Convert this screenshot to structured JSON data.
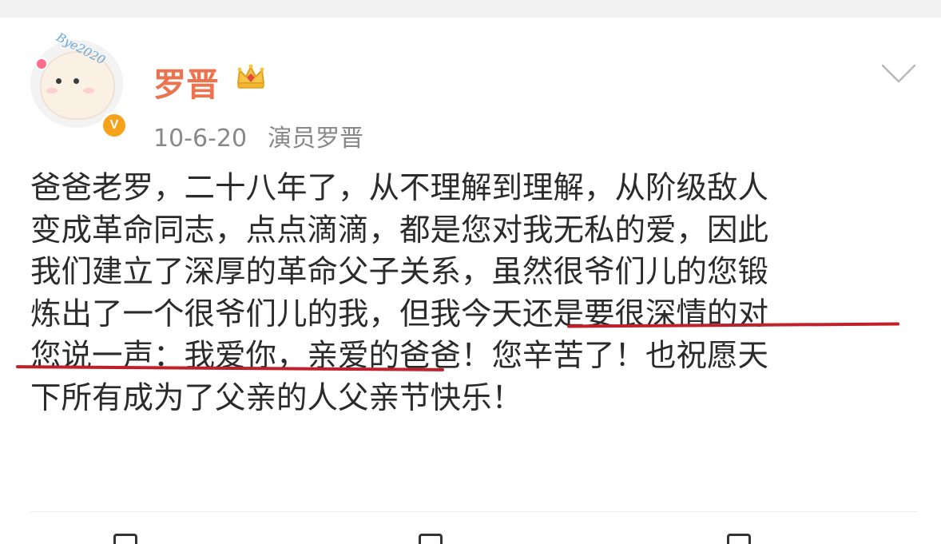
{
  "post": {
    "author": {
      "name": "罗晋",
      "avatar_caption": "Bye2020",
      "verified_mark": "V"
    },
    "meta": {
      "date": "10-6-20",
      "source": "演员罗晋"
    },
    "body_lines": [
      "爸爸老罗，二十八年了，从不理解到理解，从阶级敌人",
      "变成革命同志，点点滴滴，都是您对我无私的爱，因此",
      "我们建立了深厚的革命父子关系，虽然很爷们儿的您锻",
      "炼出了一个很爷们儿的我，但我今天还是要很深情的对",
      "您说一声：我爱你，亲爱的爸爸！您辛苦了！也祝愿天",
      "下所有成为了父亲的人父亲节快乐！"
    ]
  },
  "icons": {
    "crown": "crown-icon",
    "chevron": "chevron-down-icon",
    "verified": "verified-badge-icon",
    "repost": "repost-icon",
    "comment": "comment-icon",
    "like": "like-icon"
  },
  "colors": {
    "author_name": "#eb7350",
    "meta_text": "#888888",
    "body_text": "#2b2b2b",
    "annotation_underline": "#c0202a",
    "verified_badge": "#f7a21b",
    "top_bar": "#f2f2f2"
  }
}
